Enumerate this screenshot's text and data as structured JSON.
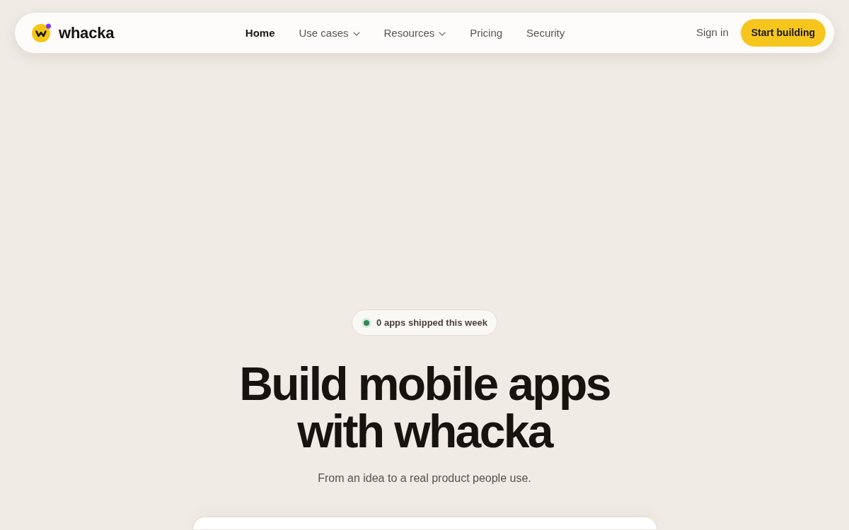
{
  "nav": {
    "brand": "whacka",
    "items": [
      {
        "label": "Home",
        "kind": "link",
        "selected": true
      },
      {
        "label": "Use cases",
        "kind": "dropdown",
        "selected": false
      },
      {
        "label": "Resources",
        "kind": "dropdown",
        "selected": false
      },
      {
        "label": "Pricing",
        "kind": "link",
        "selected": false
      },
      {
        "label": "Security",
        "kind": "link",
        "selected": false
      }
    ],
    "sign_in": "Sign in",
    "cta": "Start building"
  },
  "hero": {
    "badge": "0 apps shipped this week",
    "headline_lines": [
      "Build mobile apps",
      "with whacka"
    ],
    "subtitle": "From an idea to a real product people use."
  }
}
